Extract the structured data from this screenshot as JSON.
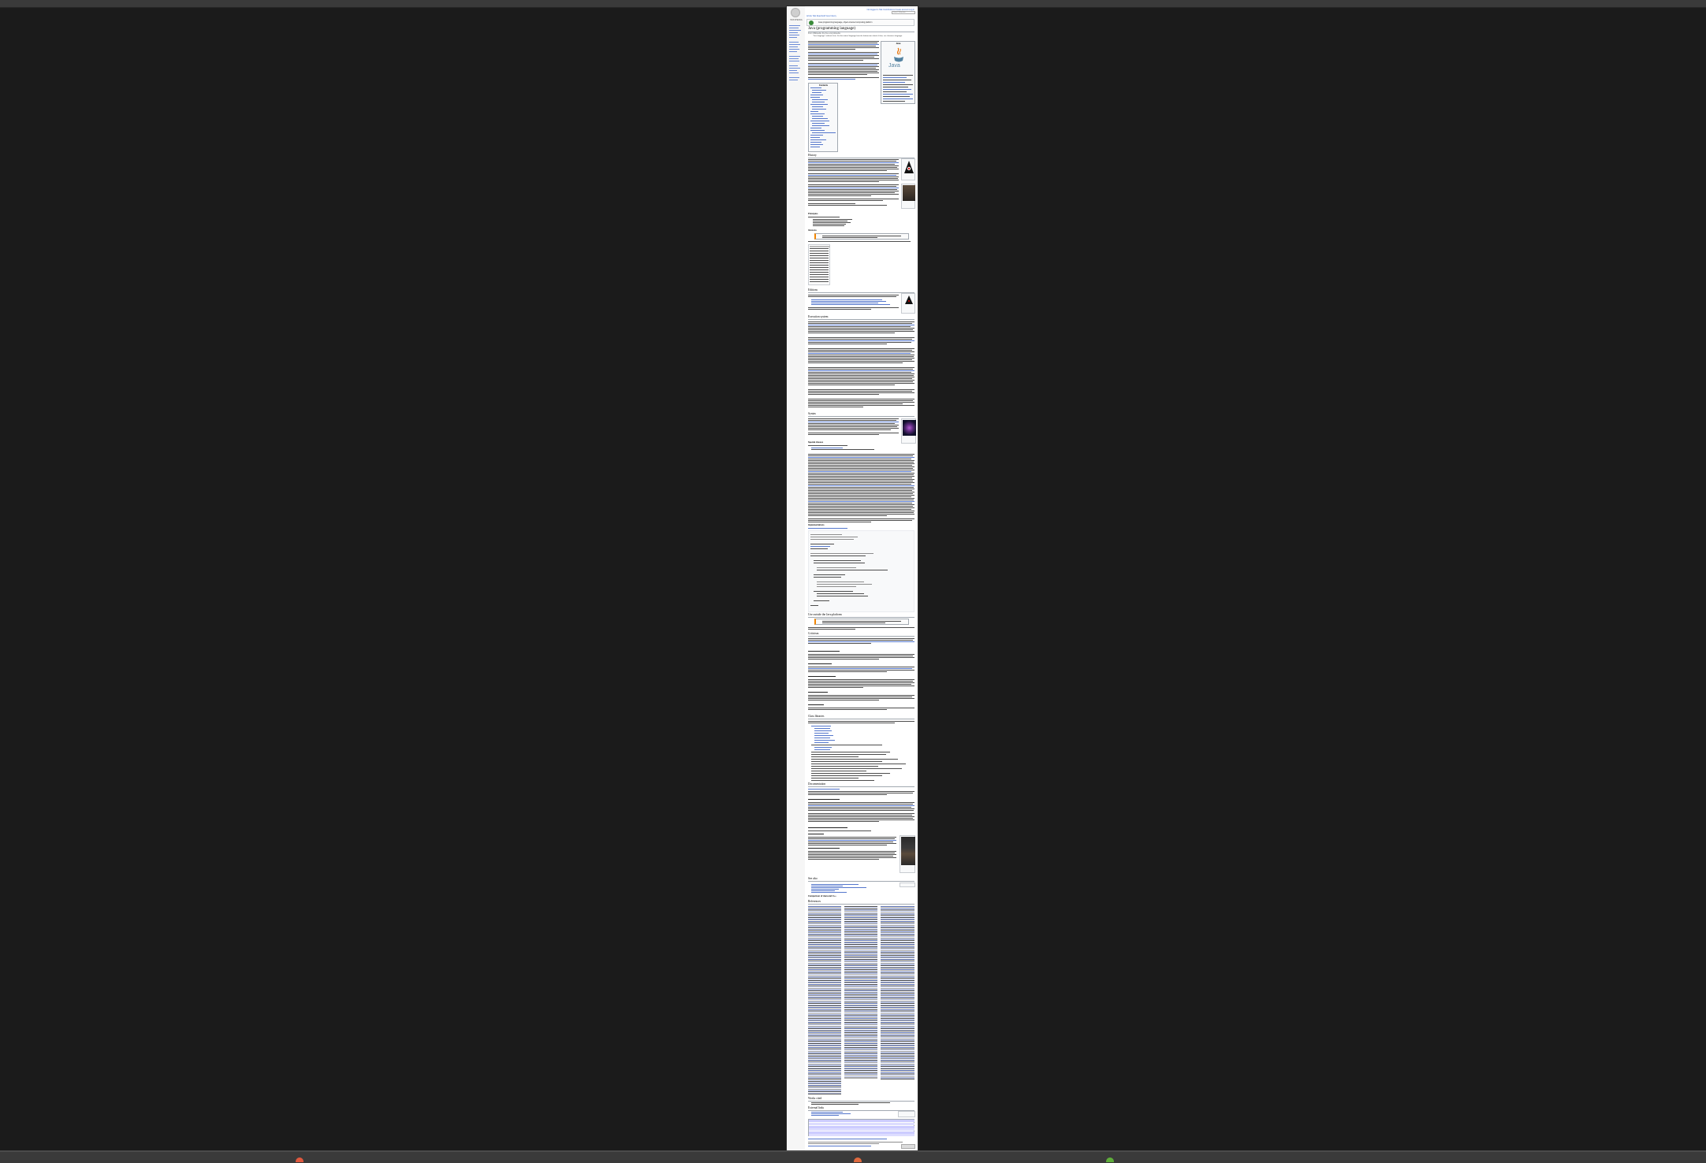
{
  "browser": {
    "taskbar_colors": [
      "#e0593f",
      "#e06a3f",
      "#5fae3b"
    ]
  },
  "wiki": {
    "logo_text": "WIKIPEDIA",
    "user_tools": "Not logged in  Talk  Contributions  Create account  Log in",
    "search_placeholder": "Search Wikipedia",
    "tabs": "Article  Talk          Read  Edit  View history",
    "banner_text": "Java programming language, object-oriented computing platform",
    "title": "Java (programming language)",
    "subtitle": "From Wikipedia, the free encyclopedia",
    "hatnote": "\"Java language\" redirects here. For the natural language from the Indonesian island of Java, see Javanese language.",
    "infobox_title": "Java",
    "java_word": "Java",
    "toc_title": "Contents",
    "sections": [
      "History",
      "Principles",
      "Versions",
      "Editions",
      "Execution system",
      "Syntax",
      "Special classes",
      "Implementations",
      "Use outside the Java platform",
      "Criticism",
      "Class libraries",
      "Documentation",
      "See also",
      "Comparison of Java and C++",
      "References",
      "Works cited",
      "External links"
    ]
  }
}
